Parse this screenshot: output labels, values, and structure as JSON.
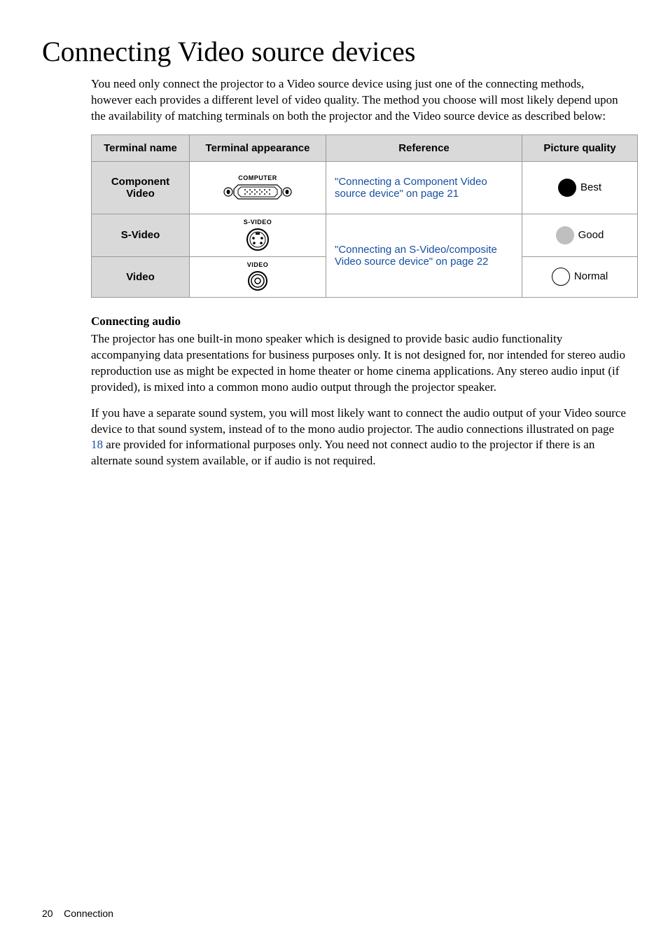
{
  "title": "Connecting Video source devices",
  "intro": "You need only connect the projector to a Video source device using just one of the connecting methods, however each provides a different level of video quality. The method you choose will most likely depend upon the availability of matching terminals on both the projector and the Video source device as described below:",
  "headers": {
    "c1": "Terminal name",
    "c2": "Terminal appearance",
    "c3": "Reference",
    "c4": "Picture quality"
  },
  "rows": {
    "r1": {
      "name": "Component Video",
      "term": "COMPUTER",
      "ref": "\"Connecting a Component Video source device\" on page 21",
      "pq": "Best"
    },
    "r2": {
      "name": "S-Video",
      "term": "S-VIDEO",
      "pq": "Good"
    },
    "r3": {
      "name": "Video",
      "term": "VIDEO",
      "pq": "Normal"
    },
    "ref23": "\"Connecting an S-Video/composite Video source device\" on page 22"
  },
  "audio_head": "Connecting audio",
  "audio_p1": "The projector has one built-in mono speaker which is designed to provide basic audio functionality accompanying data presentations for business purposes only. It is not designed for, nor intended for stereo audio reproduction use as might be expected in home theater or home cinema applications. Any stereo audio input (if provided), is mixed into a common mono audio output through the projector speaker.",
  "audio_p2a": "If you have a separate sound system, you will most likely want to connect the audio output of your Video source device to that sound system, instead of to the mono audio projector. The audio connections illustrated on page ",
  "audio_link": "18",
  "audio_p2b": " are provided for informational purposes only. You need not connect audio to the projector if there is an alternate sound system available, or if audio is not required.",
  "footer_page": "20",
  "footer_section": "Connection"
}
